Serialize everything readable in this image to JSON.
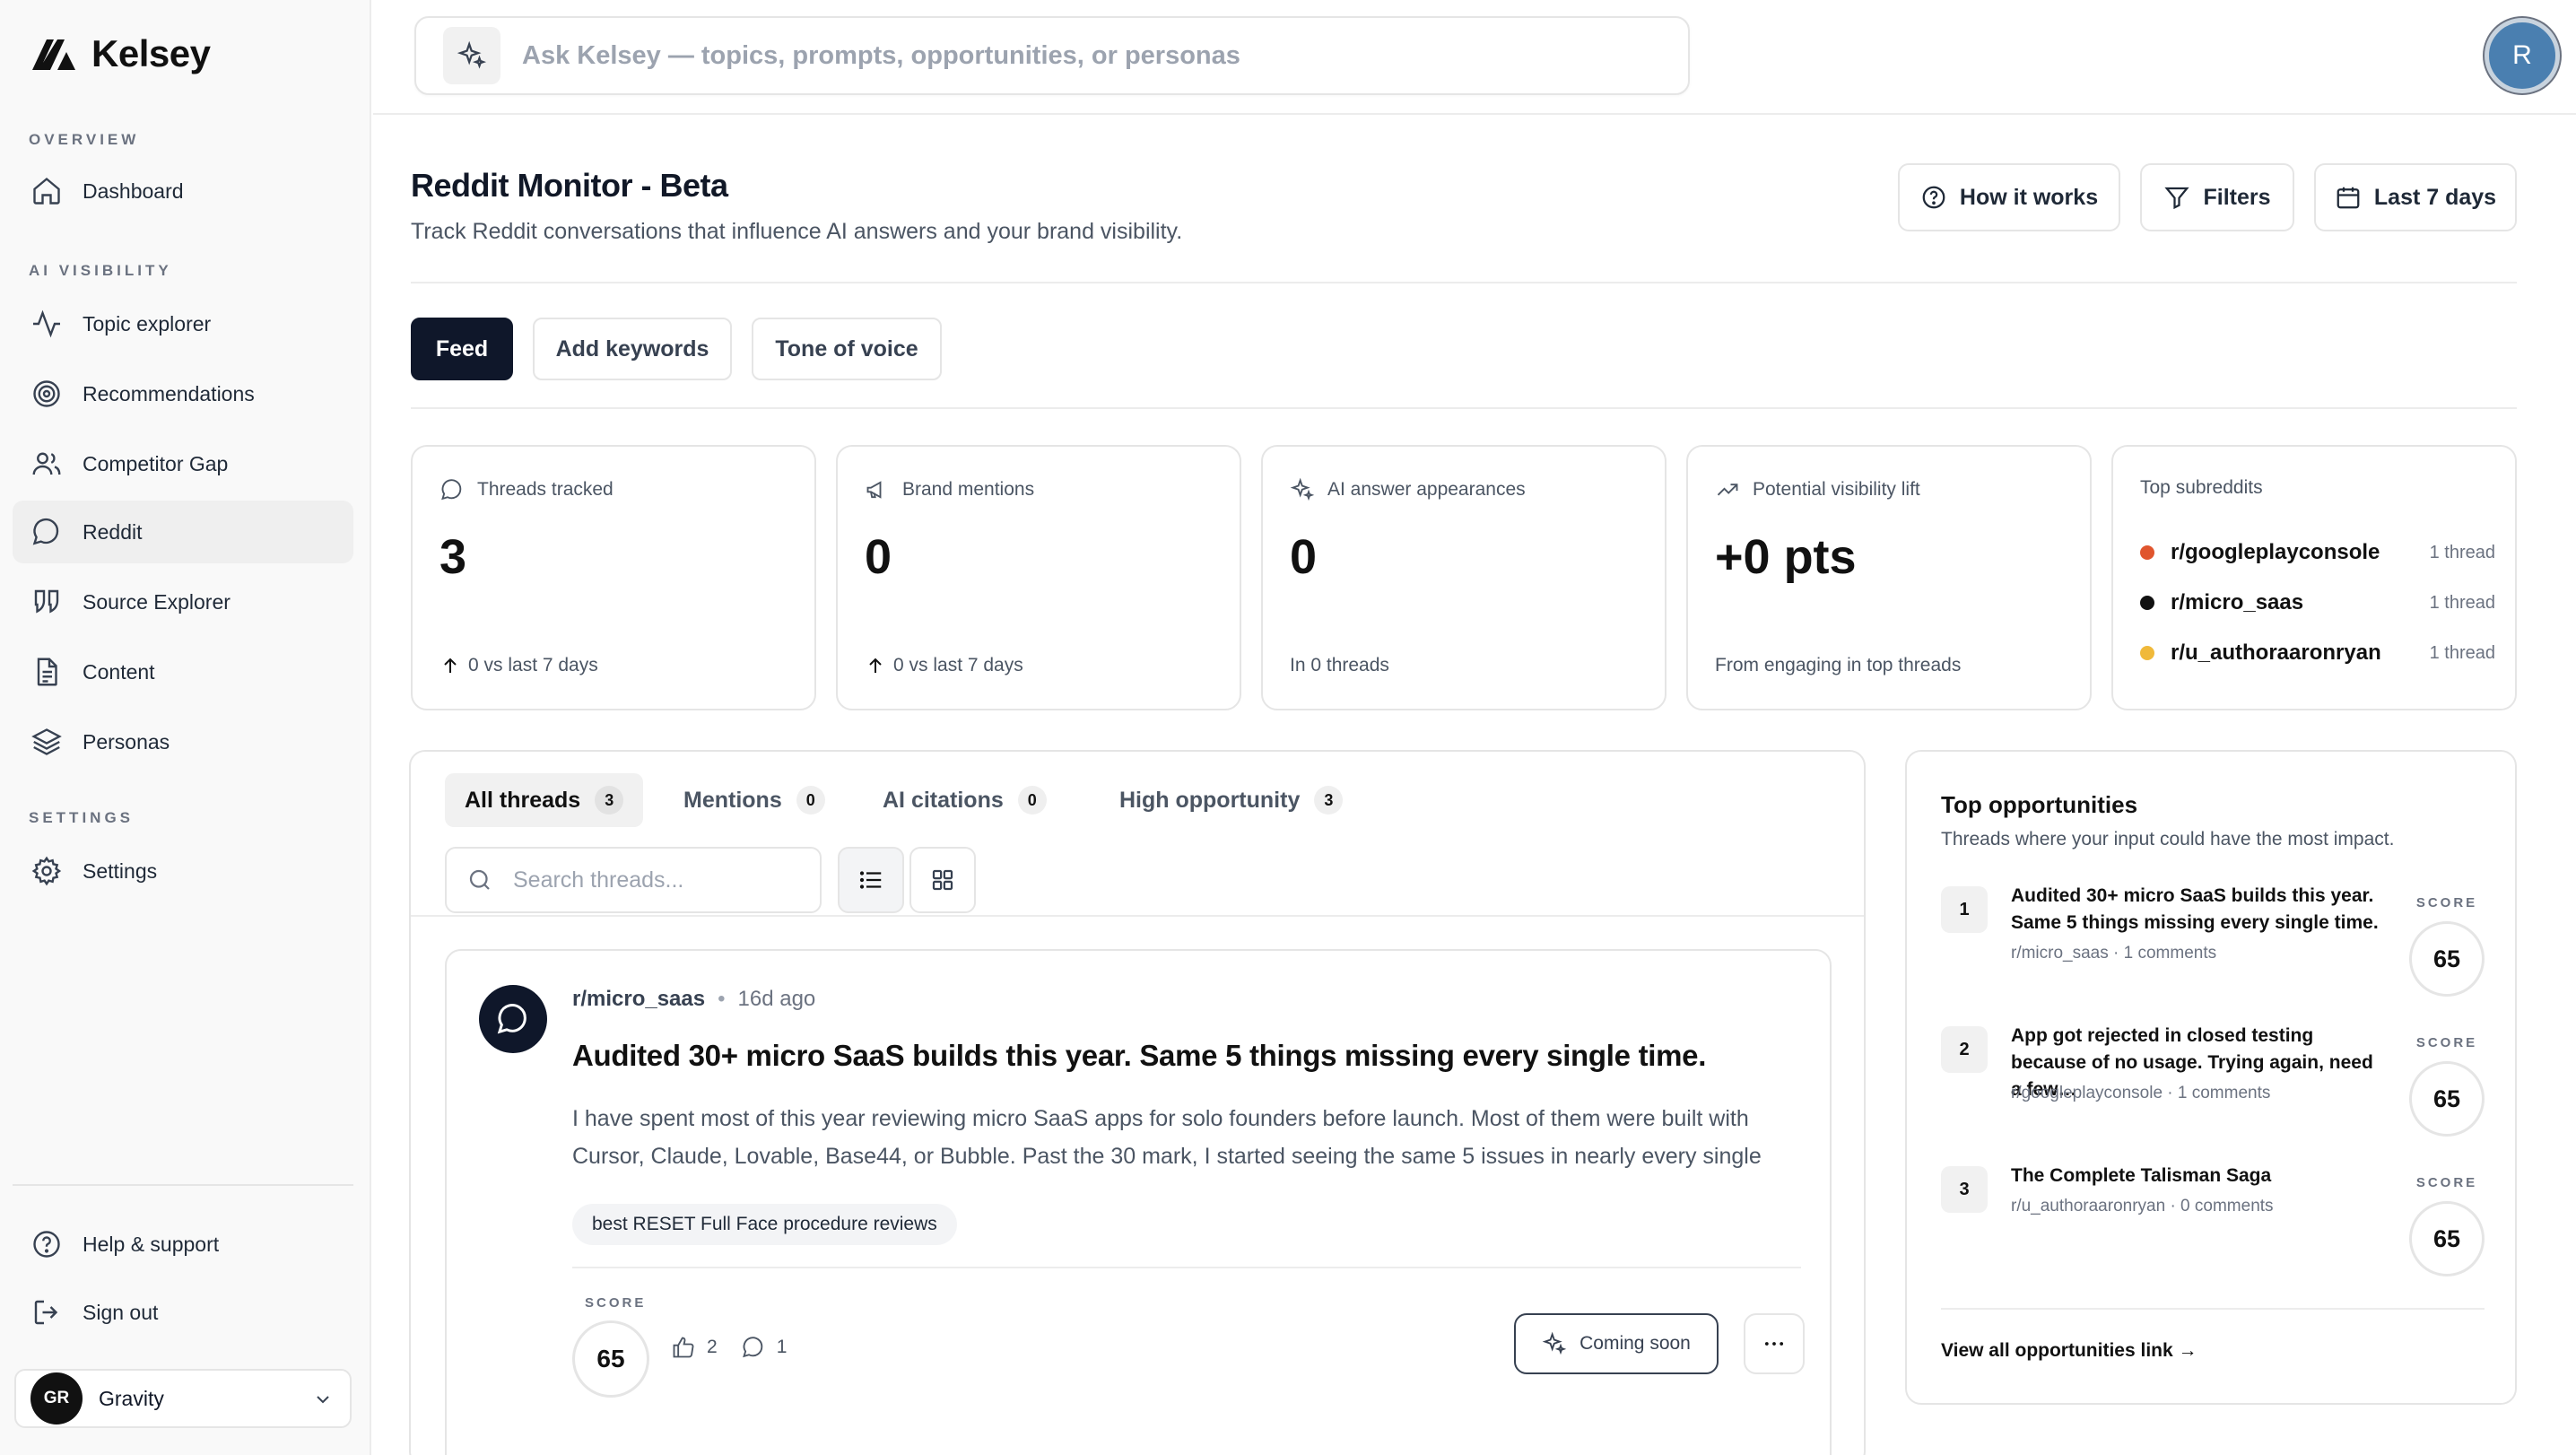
{
  "brand": {
    "name": "Kelsey"
  },
  "sidebar": {
    "sections": {
      "overview": "OVERVIEW",
      "ai_visibility": "AI VISIBILITY",
      "settings": "SETTINGS"
    },
    "items": [
      {
        "label": "Dashboard",
        "icon": "home-icon"
      },
      {
        "label": "Topic explorer",
        "icon": "activity-icon"
      },
      {
        "label": "Recommendations",
        "icon": "target-icon"
      },
      {
        "label": "Competitor Gap",
        "icon": "users-icon"
      },
      {
        "label": "Reddit",
        "icon": "message-circle-icon",
        "active": true
      },
      {
        "label": "Source Explorer",
        "icon": "quote-icon"
      },
      {
        "label": "Content",
        "icon": "document-icon"
      },
      {
        "label": "Personas",
        "icon": "layers-icon"
      },
      {
        "label": "Settings",
        "icon": "gear-icon"
      }
    ],
    "footer": {
      "help": "Help & support",
      "signout": "Sign out"
    },
    "workspace": {
      "initials": "GR",
      "name": "Gravity"
    }
  },
  "topbar": {
    "ask_placeholder": "Ask Kelsey — topics, prompts, opportunities, or personas",
    "user_initial": "R"
  },
  "header": {
    "title": "Reddit Monitor - Beta",
    "subtitle": "Track Reddit conversations that influence AI answers and your brand visibility.",
    "buttons": {
      "how": "How it works",
      "filters": "Filters",
      "range": "Last 7 days"
    }
  },
  "tabs": [
    {
      "label": "Feed",
      "active": true
    },
    {
      "label": "Add keywords"
    },
    {
      "label": "Tone of voice"
    }
  ],
  "stats": {
    "threads": {
      "label": "Threads tracked",
      "value": "3",
      "foot": "0 vs last 7 days"
    },
    "mentions": {
      "label": "Brand mentions",
      "value": "0",
      "foot": "0 vs last 7 days"
    },
    "ai": {
      "label": "AI answer appearances",
      "value": "0",
      "foot": "In 0 threads"
    },
    "lift": {
      "label": "Potential visibility lift",
      "value": "+0 pts",
      "foot": "From engaging in top threads"
    },
    "subs": {
      "label": "Top subreddits",
      "items": [
        {
          "name": "r/googleplayconsole",
          "count": "1 thread",
          "color": "#e0552e"
        },
        {
          "name": "r/micro_saas",
          "count": "1 thread",
          "color": "#111111"
        },
        {
          "name": "r/u_authoraaronryan",
          "count": "1 thread",
          "color": "#f0b93a"
        }
      ]
    }
  },
  "threads_panel": {
    "tabs": [
      {
        "label": "All threads",
        "count": "3",
        "active": true
      },
      {
        "label": "Mentions",
        "count": "0"
      },
      {
        "label": "AI citations",
        "count": "0"
      },
      {
        "label": "High opportunity",
        "count": "3"
      }
    ],
    "search_placeholder": "Search threads...",
    "thread": {
      "subreddit": "r/micro_saas",
      "age": "16d ago",
      "title": "Audited 30+ micro SaaS builds this year. Same 5 things missing every single time.",
      "body": "I have spent most of this year reviewing micro SaaS apps for solo founders before launch. Most of them were built with Cursor, Claude, Lovable, Base44, or Bubble. Past the 30 mark, I started seeing the same 5 issues in nearly every single one....",
      "tag": "best RESET Full Face procedure reviews",
      "score_label": "SCORE",
      "score": "65",
      "upvotes": "2",
      "comments": "1",
      "coming_soon": "Coming soon"
    }
  },
  "opportunities": {
    "title": "Top opportunities",
    "subtitle": "Threads where your input could have the most impact.",
    "score_label": "SCORE",
    "items": [
      {
        "rank": "1",
        "title": "Audited 30+ micro SaaS builds this year. Same 5 things missing every single time.",
        "meta": "r/micro_saas · 1 comments",
        "score": "65"
      },
      {
        "rank": "2",
        "title": "App got rejected in closed testing because of no usage. Trying again, need a few…",
        "meta": "r/googleplayconsole · 1 comments",
        "score": "65"
      },
      {
        "rank": "3",
        "title": "The Complete Talisman Saga",
        "meta": "r/u_authoraaronryan · 0 comments",
        "score": "65"
      }
    ],
    "link": "View all opportunities link →"
  }
}
